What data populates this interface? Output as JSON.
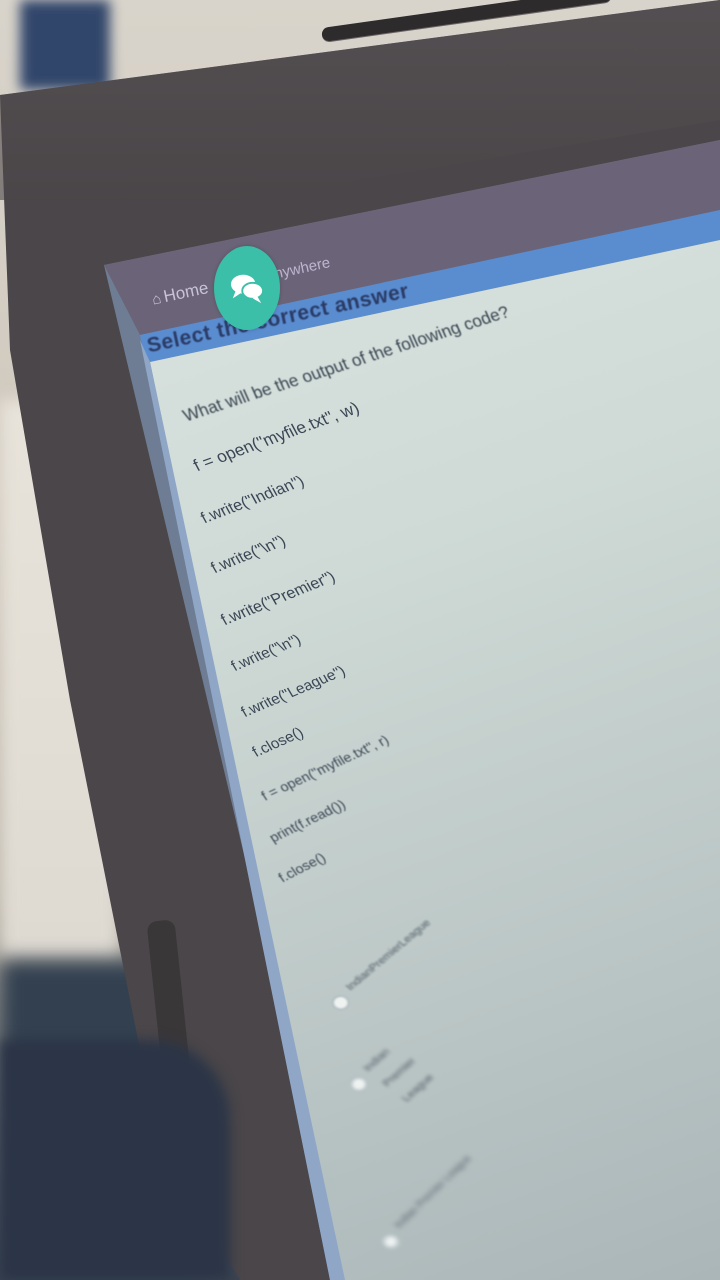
{
  "breadcrumb": {
    "home": "Home",
    "right": "n Anywhere"
  },
  "section": {
    "title": "Select the correct answer"
  },
  "chat": {
    "icon": "chat-bubbles-icon",
    "color": "#3bbfa8"
  },
  "question": {
    "text": "What will be the output of the following code?",
    "code": [
      "f = open(\"myfile.txt\", w)",
      "f.write(\"Indian\")",
      "f.write(\"\\n\")",
      "f.write(\"Premier\")",
      "f.write(\"\\n\")",
      "f.write(\"League\")",
      "f.close()",
      "f = open(\"myfile.txt\", r)",
      "print(f.read())",
      "f.close()"
    ]
  },
  "options": [
    {
      "lines": [
        "IndianPremierLeague"
      ]
    },
    {
      "lines": [
        "Indian",
        "Premier",
        "League"
      ]
    },
    {
      "lines": [
        "Indian Premier League"
      ]
    }
  ],
  "colors": {
    "accent_blue": "#5a8cd0",
    "bezel": "#4a4649",
    "screen_bg": "#dfe7e3"
  }
}
